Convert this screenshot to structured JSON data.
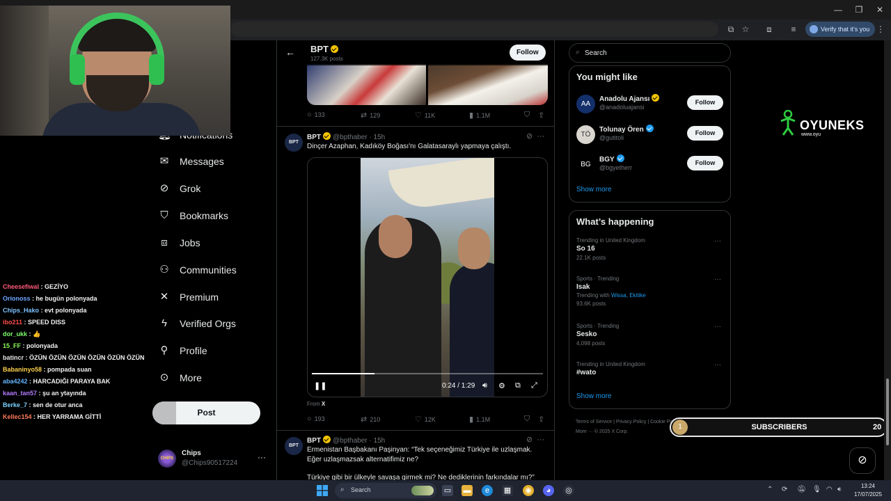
{
  "browser": {
    "verify_label": "Verify that it's you"
  },
  "chat": [
    {
      "user": "Cheesefiwal",
      "msg": "GEZİYO",
      "color": "#ff5a78"
    },
    {
      "user": "Orionoss",
      "msg": "he bugün polonyada",
      "color": "#6fa8ff"
    },
    {
      "user": "Chips_Hako",
      "msg": "evt polonyada",
      "color": "#7ec4ff"
    },
    {
      "user": "ibo211",
      "msg": "SPEED DISS",
      "color": "#ff4d4d"
    },
    {
      "user": "dor_ukk",
      "msg": "👍",
      "color": "#7dff6e"
    },
    {
      "user": "15_FF",
      "msg": "polonyada",
      "color": "#8cff5a"
    },
    {
      "user": "batincr",
      "msg": "ÖZÜN ÖZÜN ÖZÜN ÖZÜN ÖZÜN ÖZÜN",
      "color": "#e8e8e8"
    },
    {
      "user": "Babaninyo58",
      "msg": "pompada suan",
      "color": "#ffd34d"
    },
    {
      "user": "aba4242",
      "msg": "HARCADIĞI PARAYA BAK",
      "color": "#64b5ff"
    },
    {
      "user": "kaan_tan57",
      "msg": "şu an ytayında",
      "color": "#b47cff"
    },
    {
      "user": "Berke_7",
      "msg": "sen de otur anca",
      "color": "#7dd3ff"
    },
    {
      "user": "Kellec154",
      "msg": "HER YARRAMA GİTTİ",
      "color": "#ff7a5a"
    }
  ],
  "nav": {
    "partial": "Notifications",
    "items": [
      {
        "label": "Messages",
        "icon": "envelope-icon"
      },
      {
        "label": "Grok",
        "icon": "grok-icon"
      },
      {
        "label": "Bookmarks",
        "icon": "bookmark-icon"
      },
      {
        "label": "Jobs",
        "icon": "briefcase-icon"
      },
      {
        "label": "Communities",
        "icon": "people-icon"
      },
      {
        "label": "Premium",
        "icon": "x-logo-icon"
      },
      {
        "label": "Verified Orgs",
        "icon": "lightning-icon"
      },
      {
        "label": "Profile",
        "icon": "person-icon"
      },
      {
        "label": "More",
        "icon": "more-circle-icon"
      }
    ],
    "post_label": "Post"
  },
  "account": {
    "name": "Chips",
    "handle": "@Chips90517224",
    "avatar_text": "CHIPS"
  },
  "profile_header": {
    "name": "BPT",
    "posts": "127.3K posts",
    "follow": "Follow"
  },
  "prev_tweet": {
    "replies": "133",
    "reposts": "129",
    "likes": "11K",
    "views": "1.1M"
  },
  "tweet1": {
    "avatar": "BPT",
    "name": "BPT",
    "meta": "@bpthaber · 15h",
    "text": "Dinçer Azaphan, Kadıköy Boğası'nı Galatasaraylı yapmaya çalıştı.",
    "video_time": "0:24 / 1:29",
    "video_progress": 0.27,
    "from_prefix": "From",
    "from_source": "X",
    "replies": "193",
    "reposts": "210",
    "likes": "12K",
    "views": "1.1M"
  },
  "tweet2": {
    "avatar": "BPT",
    "name": "BPT",
    "meta": "@bpthaber · 15h",
    "text": "Ermenistan Başbakanı Paşinyan: “Tek seçeneğimiz Türkiye ile uzlaşmak. Eğer uzlaşmazsak alternatifimiz ne?",
    "text2": "Türkiye gibi bir ülkeyle savaşa girmek mi? Ne dediklerinin farkındalar mı?”"
  },
  "search": {
    "placeholder": "Search"
  },
  "you_might_like": {
    "title": "You might like",
    "accounts": [
      {
        "name": "Anadolu Ajansı",
        "handle": "@anadoluajansi",
        "verified": "gold",
        "follow": "Follow"
      },
      {
        "name": "Tolunay Ören",
        "handle": "@gutitoli",
        "verified": "blue",
        "follow": "Follow"
      },
      {
        "name": "BGY",
        "handle": "@bgyetherr",
        "verified": "blue",
        "follow": "Follow"
      }
    ],
    "show_more": "Show more"
  },
  "whats_happening": {
    "title": "What’s happening",
    "trends": [
      {
        "context": "Trending in United Kingdom",
        "name": "So 16",
        "with": "",
        "with_links": "",
        "count": "22.1K posts"
      },
      {
        "context": "Sports · Trending",
        "name": "Isak",
        "with": "Trending with",
        "with_links": "Wissa, Ekitike",
        "count": "93.6K posts"
      },
      {
        "context": "Sports · Trending",
        "name": "Sesko",
        "with": "",
        "with_links": "",
        "count": "4,098 posts"
      },
      {
        "context": "Trending in United Kingdom",
        "name": "#wato",
        "with": "",
        "with_links": "",
        "count": ""
      }
    ],
    "show_more": "Show more"
  },
  "footer": {
    "line1": "Terms of Service  |  Privacy Policy  |  Cookie Policy  |",
    "line2": "More ···  © 2025 X Corp."
  },
  "sponsor": {
    "name": "OYUNEKS",
    "url": "www.oyu"
  },
  "subscribers": {
    "goal_index": "1",
    "label": "SUBSCRIBERS",
    "count": "20"
  },
  "taskbar": {
    "search_label": "Search",
    "time": "13:24",
    "date": "17/07/2025"
  },
  "colors": {
    "accent_blue": "#1d9bf0",
    "verified_gold": "#f2c400",
    "headset_green": "#3cc45c"
  }
}
